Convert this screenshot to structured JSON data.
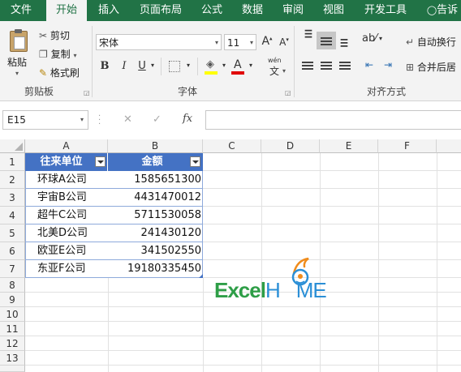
{
  "tabs": [
    "文件",
    "开始",
    "插入",
    "页面布局",
    "公式",
    "数据",
    "审阅",
    "视图",
    "开发工具",
    "告诉"
  ],
  "tell_icon": "lightbulb-icon",
  "clipboard": {
    "paste": "粘贴",
    "cut": "剪切",
    "copy": "复制",
    "format_painter": "格式刷",
    "group_label": "剪贴板"
  },
  "font": {
    "name": "宋体",
    "size": "11",
    "grow": "A",
    "shrink": "A",
    "bold": "B",
    "italic": "I",
    "underline": "U",
    "font_color_letter": "A",
    "wen": "wén",
    "group_label": "字体"
  },
  "alignment": {
    "wrap_text": "自动换行",
    "merge_center": "合并后居",
    "group_label": "对齐方式"
  },
  "formula_bar": {
    "name_box": "E15",
    "cancel": "✕",
    "enter": "✓",
    "fx": "fx",
    "formula": ""
  },
  "columns": [
    "A",
    "B",
    "C",
    "D",
    "E",
    "F"
  ],
  "rows": [
    "1",
    "2",
    "3",
    "4",
    "5",
    "6",
    "7",
    "8",
    "9",
    "10",
    "11",
    "12",
    "13"
  ],
  "table": {
    "header": [
      "往来单位",
      "金额"
    ],
    "rows": [
      [
        "环球A公司",
        "1585651300"
      ],
      [
        "宇宙B公司",
        "4431470012"
      ],
      [
        "超牛C公司",
        "5711530058"
      ],
      [
        "北美D公司",
        "241430120"
      ],
      [
        "欧亚E公司",
        "341502550"
      ],
      [
        "东亚F公司",
        "19180335450"
      ]
    ]
  },
  "logo": {
    "part1": "Excel",
    "part2": "H",
    "part3": "ME",
    "color1": "#2e9e47",
    "color2": "#2b8fd6",
    "accent": "#f08c1c"
  },
  "colors": {
    "ribbon_green": "#217346",
    "table_header": "#4472c4"
  }
}
